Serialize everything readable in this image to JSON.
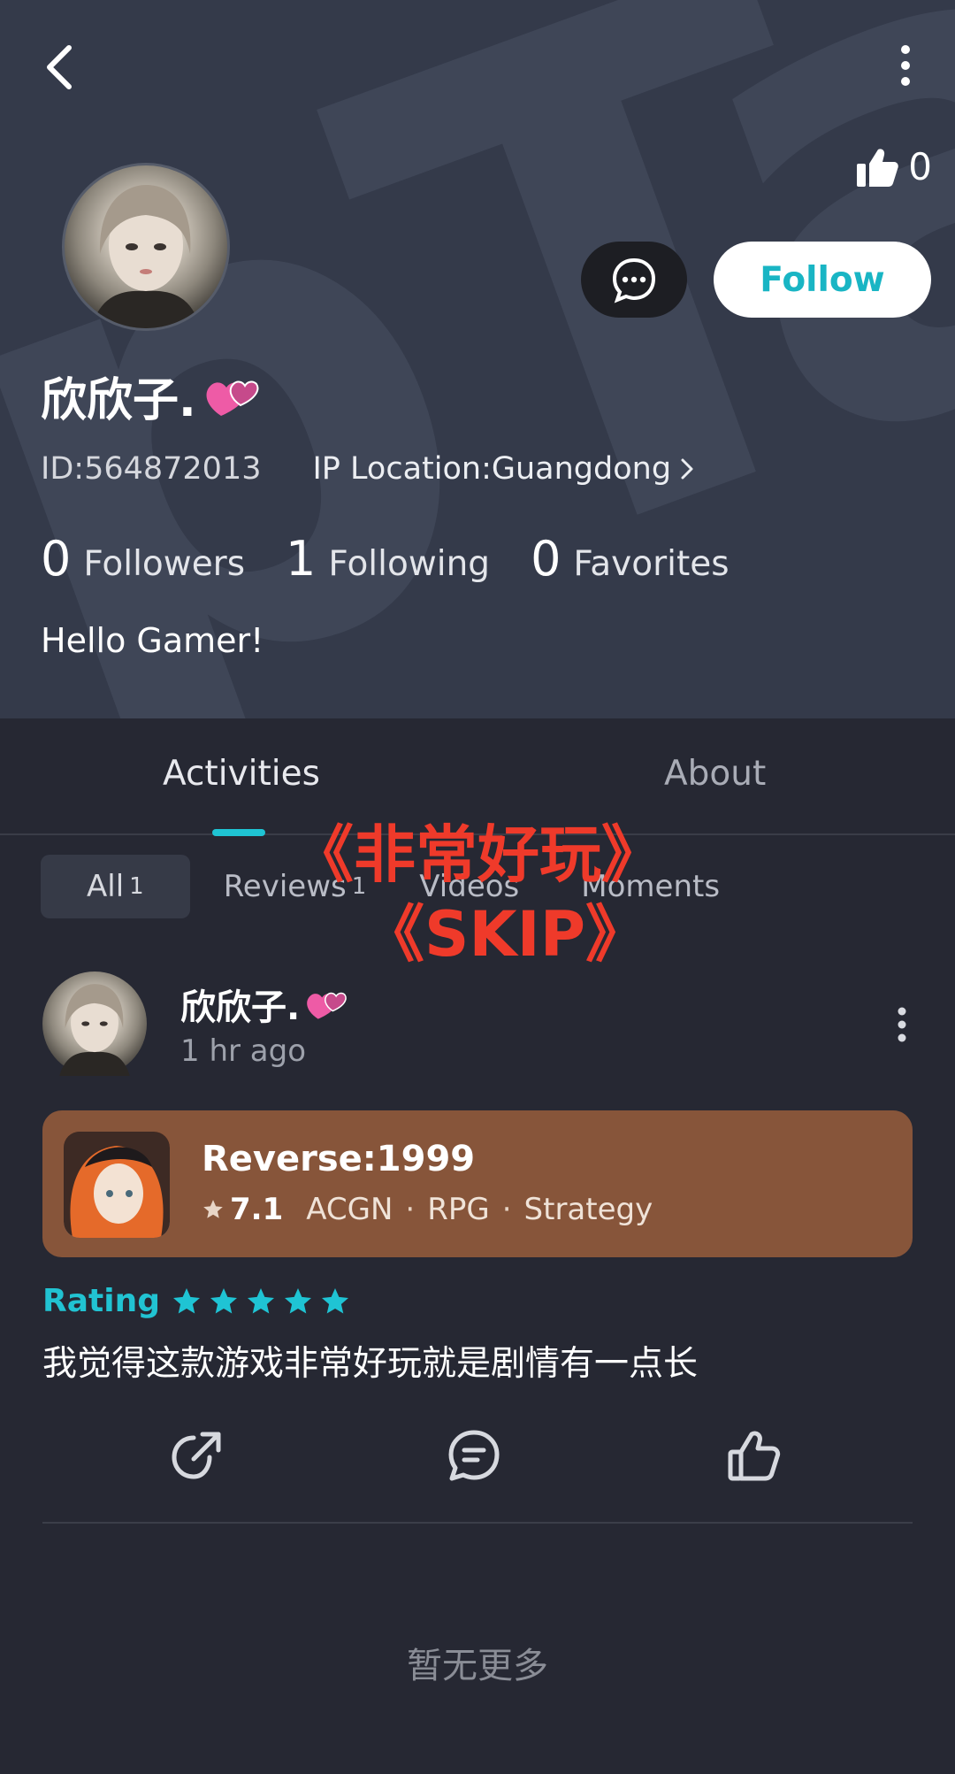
{
  "header": {
    "likes_count": "0",
    "follow_label": "Follow"
  },
  "profile": {
    "username": "欣欣子.",
    "id_text": "ID:564872013",
    "ip_location": "IP Location:Guangdong",
    "followers_count": "0",
    "followers_label": "Followers",
    "following_count": "1",
    "following_label": "Following",
    "favorites_count": "0",
    "favorites_label": "Favorites",
    "bio": "Hello Gamer!"
  },
  "tabs": [
    {
      "label": "Activities",
      "active": true
    },
    {
      "label": "About",
      "active": false
    }
  ],
  "filters": {
    "all_label": "All",
    "all_count": "1",
    "reviews_label": "Reviews",
    "reviews_count": "1",
    "videos_label": "Videos",
    "moments_label": "Moments"
  },
  "overlay": {
    "line1": "《非常好玩》",
    "line2": "《SKIP》"
  },
  "post": {
    "username": "欣欣子.",
    "time": "1 hr ago",
    "game": {
      "title": "Reverse:1999",
      "score": "7.1",
      "tags": [
        "ACGN",
        "RPG",
        "Strategy"
      ]
    },
    "rating_label": "Rating",
    "rating_stars": 5,
    "review_text": "我觉得这款游戏非常好玩就是剧情有一点长"
  },
  "footer": {
    "no_more_text": "暂无更多"
  },
  "colors": {
    "accent": "#1fc4d4",
    "hero_bg": "#343a4a",
    "page_bg": "#262833",
    "game_card_bg": "#87553a",
    "overlay_red": "#ef3a2a"
  }
}
